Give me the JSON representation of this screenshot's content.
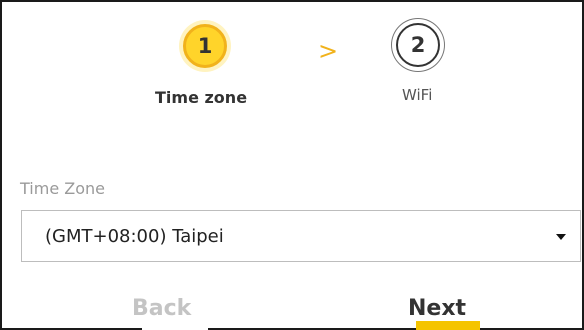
{
  "wizard": {
    "steps": [
      {
        "number": "1",
        "label": "Time zone",
        "state": "active"
      },
      {
        "number": "2",
        "label": "WiFi",
        "state": "inactive"
      }
    ],
    "separator": ">"
  },
  "time_zone": {
    "label": "Time Zone",
    "selected": "(GMT+08:00) Taipei"
  },
  "actions": {
    "back_label": "Back",
    "next_label": "Next"
  },
  "colors": {
    "accent": "#ffd42a",
    "accent_border": "#f1b21b",
    "text": "#333333",
    "muted": "#9a9a9a"
  },
  "icons": {
    "dropdown": "caret-down-icon"
  }
}
